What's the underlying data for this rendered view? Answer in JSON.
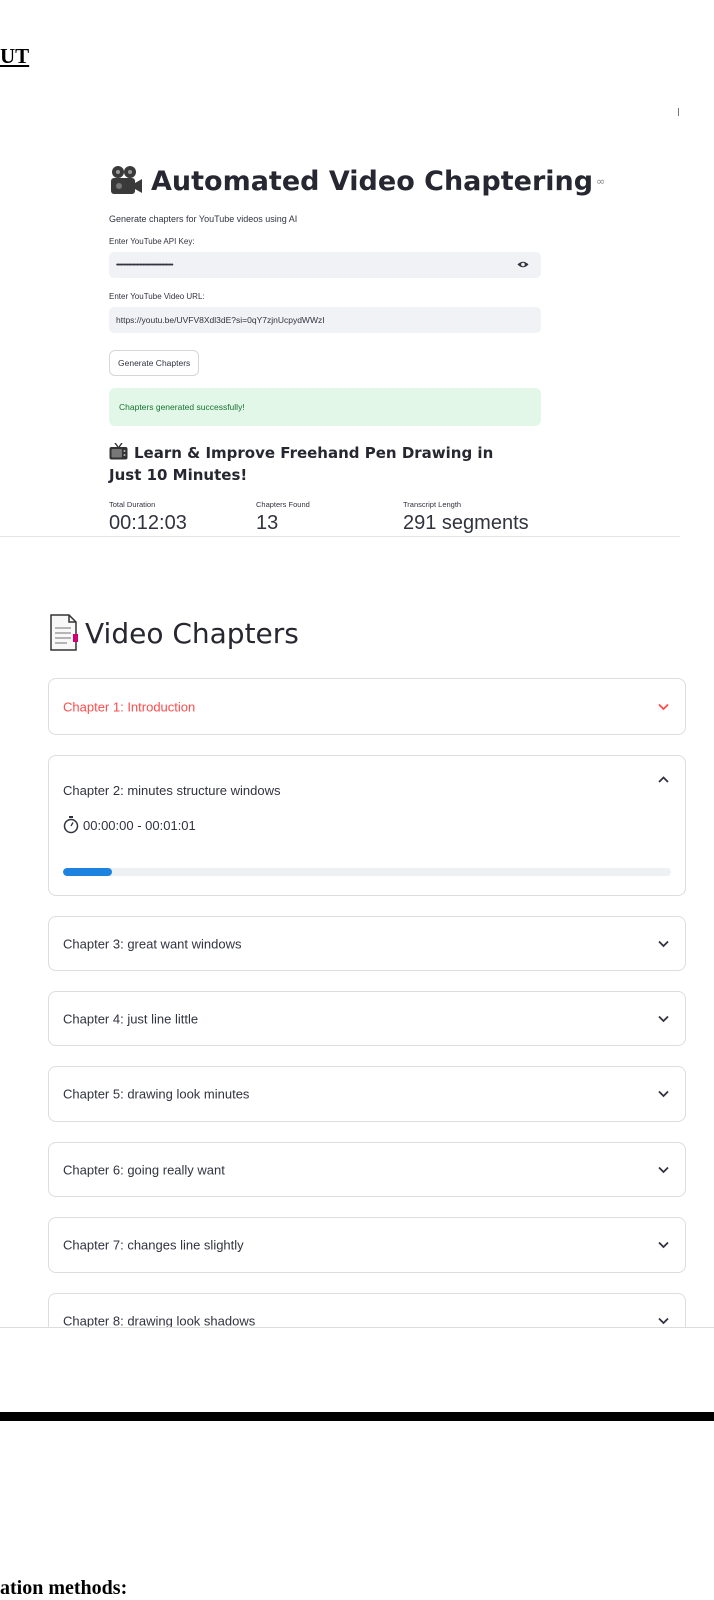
{
  "fragments": {
    "top": "UT",
    "bottom": "ation methods:"
  },
  "app": {
    "title": "Automated Video Chaptering",
    "title_link": "∞",
    "subtitle": "Generate chapters for YouTube videos using AI",
    "api_key_label": "Enter YouTube API Key:",
    "api_key_value": "•••••••••••••••••••••••••••••••••••••••",
    "url_label": "Enter YouTube Video URL:",
    "url_value": "https://youtu.be/UVFV8Xdl3dE?si=0qY7zjnUcpydWWzI",
    "generate_button": "Generate Chapters",
    "success_message": "Chapters generated successfully!",
    "video_title": "Learn & Improve Freehand Pen Drawing in Just 10 Minutes!",
    "metrics": [
      {
        "label": "Total Duration",
        "value": "00:12:03"
      },
      {
        "label": "Chapters Found",
        "value": "13"
      },
      {
        "label": "Transcript Length",
        "value": "291 segments"
      }
    ]
  },
  "chapters_section": {
    "heading": "Video Chapters",
    "chapters": [
      {
        "title": "Chapter 1: Introduction",
        "state": "collapsed-active"
      },
      {
        "title": "Chapter 2: minutes structure windows",
        "state": "expanded",
        "time_range": "00:00:00 - 00:01:01",
        "progress": 0.08
      },
      {
        "title": "Chapter 3: great want windows",
        "state": "collapsed"
      },
      {
        "title": "Chapter 4: just line little",
        "state": "collapsed"
      },
      {
        "title": "Chapter 5: drawing look minutes",
        "state": "collapsed"
      },
      {
        "title": "Chapter 6: going really want",
        "state": "collapsed"
      },
      {
        "title": "Chapter 7: changes line slightly",
        "state": "collapsed"
      },
      {
        "title": "Chapter 8: drawing look shadows",
        "state": "collapsed"
      }
    ]
  },
  "colors": {
    "accent_red": "#ff4b4b",
    "progress_blue": "#1c83e1",
    "success_bg": "#e2f7e8",
    "success_text": "#177233"
  }
}
